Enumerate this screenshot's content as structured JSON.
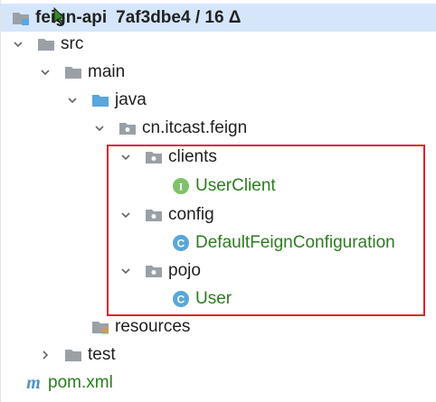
{
  "tree": {
    "root": {
      "label": "feign-api",
      "meta": "7af3dbe4 / 16 Δ"
    },
    "items": [
      {
        "label": "src"
      },
      {
        "label": "main"
      },
      {
        "label": "java"
      },
      {
        "label": "cn.itcast.feign"
      },
      {
        "label": "clients"
      },
      {
        "label": "UserClient",
        "kind_badge": "I"
      },
      {
        "label": "config"
      },
      {
        "label": "DefaultFeignConfiguration",
        "kind_badge": "C"
      },
      {
        "label": "pojo"
      },
      {
        "label": "User",
        "kind_badge": "C"
      },
      {
        "label": "resources"
      },
      {
        "label": "test"
      },
      {
        "label": "pom.xml",
        "kind_badge": "m"
      }
    ]
  },
  "colors": {
    "selection": "#d5e6fb",
    "highlight_border": "#e0222b",
    "class_text": "#2a7d1e",
    "folder_gray": "#9aa0a6",
    "folder_blue": "#5aa6dd",
    "interface_badge": "#7ec26a",
    "class_badge": "#59a7da"
  }
}
